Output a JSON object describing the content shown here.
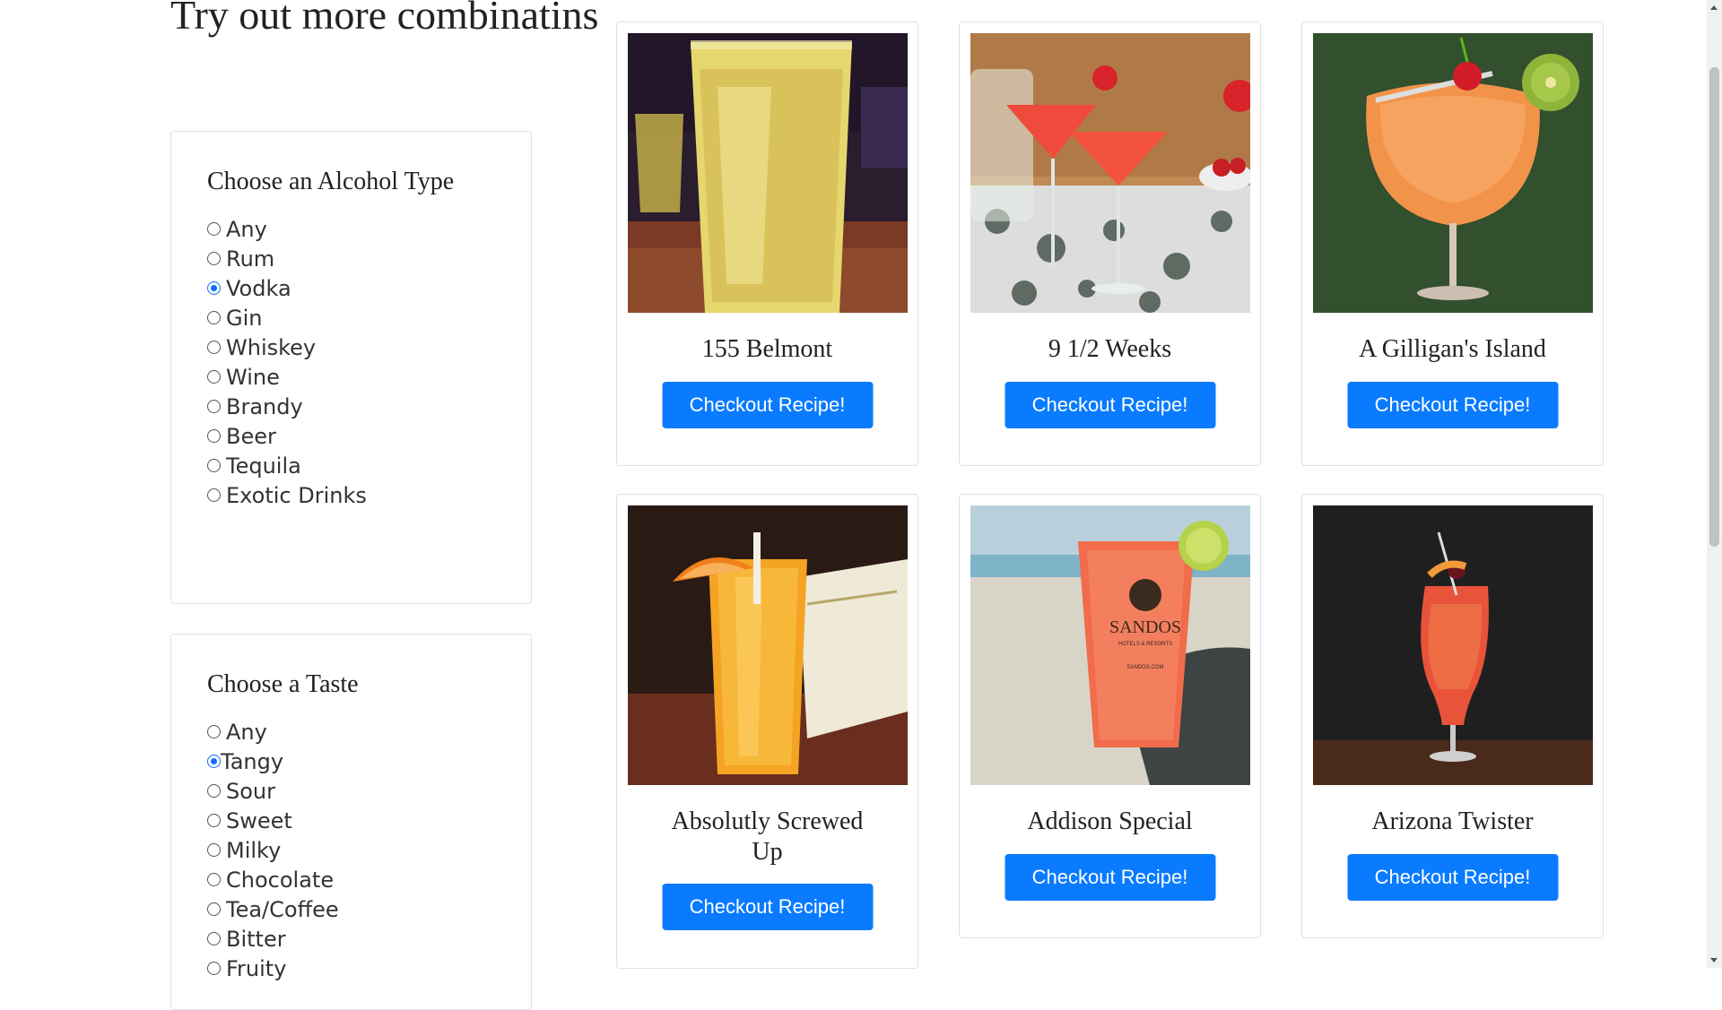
{
  "page": {
    "title": "Try out more combinatins"
  },
  "filters": {
    "alcohol": {
      "heading": "Choose an Alcohol Type",
      "options": [
        "Any",
        "Rum",
        "Vodka",
        "Gin",
        "Whiskey",
        "Wine",
        "Brandy",
        "Beer",
        "Tequila",
        "Exotic Drinks"
      ],
      "selected": "Vodka"
    },
    "taste": {
      "heading": "Choose a Taste",
      "options": [
        "Any",
        "Tangy",
        "Sour",
        "Sweet",
        "Milky",
        "Chocolate",
        "Tea/Coffee",
        "Bitter",
        "Fruity"
      ],
      "selected": "Tangy"
    }
  },
  "drinks": [
    {
      "name": "155 Belmont",
      "button": "Checkout Recipe!"
    },
    {
      "name": "9 1/2 Weeks",
      "button": "Checkout Recipe!"
    },
    {
      "name": "A Gilligan's Island",
      "button": "Checkout Recipe!"
    },
    {
      "name": "Absolutly Screwed Up",
      "button": "Checkout Recipe!"
    },
    {
      "name": "Addison Special",
      "button": "Checkout Recipe!"
    },
    {
      "name": "Arizona Twister",
      "button": "Checkout Recipe!"
    }
  ],
  "photo_text": {
    "brand": "SANDOS",
    "brand_sub": "HOTELS & RESORTS",
    "brand_url": "SANDOS.COM"
  },
  "colors": {
    "button_bg": "#0a7bff",
    "radio_checked": "#0d6efd",
    "card_border": "#dee2e6"
  }
}
